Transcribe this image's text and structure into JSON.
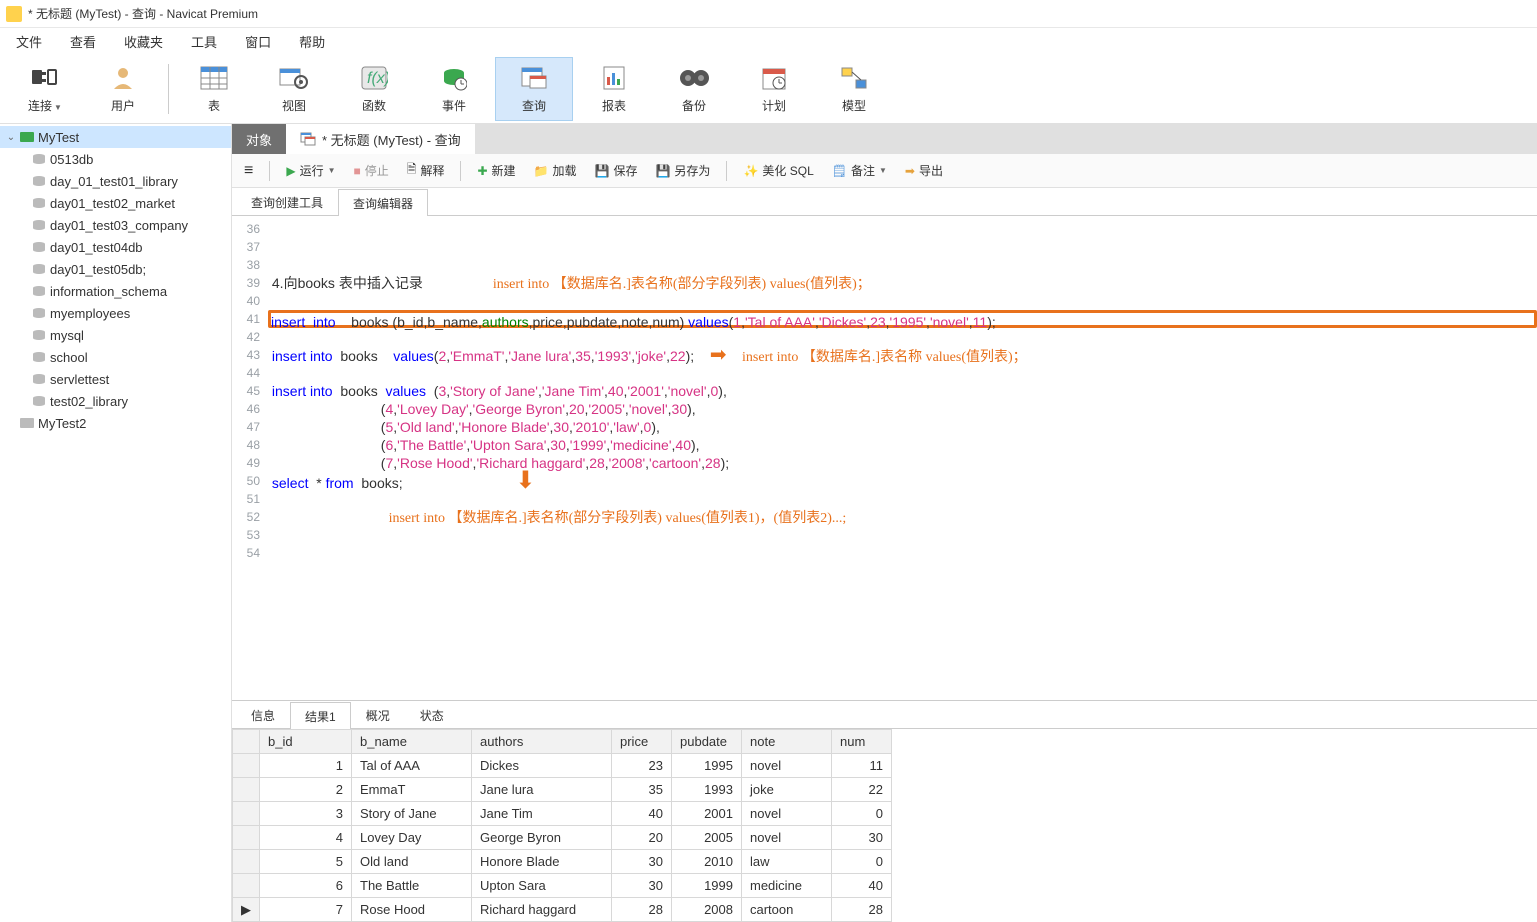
{
  "title": "* 无标题 (MyTest) - 查询 - Navicat Premium",
  "menu": [
    "文件",
    "查看",
    "收藏夹",
    "工具",
    "窗口",
    "帮助"
  ],
  "maintool": {
    "connect": "连接",
    "user": "用户",
    "table": "表",
    "view": "视图",
    "function": "函数",
    "event": "事件",
    "query": "查询",
    "report": "报表",
    "backup": "备份",
    "plan": "计划",
    "model": "模型"
  },
  "tree": {
    "root": "MyTest",
    "items": [
      "0513db",
      "day_01_test01_library",
      "day01_test02_market",
      "day01_test03_company",
      "day01_test04db",
      "day01_test05db;",
      "information_schema",
      "myemployees",
      "mysql",
      "school",
      "servlettest",
      "test02_library"
    ],
    "root2": "MyTest2"
  },
  "tabs": {
    "objects": "对象",
    "query": "* 无标题 (MyTest) - 查询"
  },
  "qtb": {
    "run": "运行",
    "stop": "停止",
    "explain": "解释",
    "new": "新建",
    "load": "加载",
    "save": "保存",
    "saveas": "另存为",
    "beautify": "美化 SQL",
    "note": "备注",
    "export": "导出"
  },
  "innertabs": {
    "builder": "查询创建工具",
    "editor": "查询编辑器"
  },
  "code": {
    "l39_comment": "4.向books 表中插入记录",
    "anno1": "insert into 【数据库名.]表名称(部分字段列表) values(值列表)；",
    "l41": "insert  into    books (b_id,b_name,authors,price,pubdate,note,num) values(1,'Tal of AAA','Dickes',23,'1995','novel',11);",
    "l43": "insert into  books    values(2,'EmmaT','Jane lura',35,'1993','joke',22);",
    "anno2": "insert into 【数据库名.]表名称 values(值列表)；",
    "l45": "insert into  books  values  (3,'Story of Jane','Jane Tim',40,'2001','novel',0),",
    "l46": "                            (4,'Lovey Day','George Byron',20,'2005','novel',30),",
    "l47": "                            (5,'Old land','Honore Blade',30,'2010','law',0),",
    "l48": "                            (6,'The Battle','Upton Sara',30,'1999','medicine',40),",
    "l49": "                            (7,'Rose Hood','Richard haggard',28,'2008','cartoon',28);",
    "l50": "select  * from  books;",
    "anno3": "insert into 【数据库名.]表名称(部分字段列表) values(值列表1)，(值列表2)...;"
  },
  "resulttabs": {
    "info": "信息",
    "res1": "结果1",
    "profile": "概况",
    "status": "状态"
  },
  "grid": {
    "headers": [
      "b_id",
      "b_name",
      "authors",
      "price",
      "pubdate",
      "note",
      "num"
    ],
    "rows": [
      {
        "b_id": 1,
        "b_name": "Tal of AAA",
        "authors": "Dickes",
        "price": 23,
        "pubdate": 1995,
        "note": "novel",
        "num": 11
      },
      {
        "b_id": 2,
        "b_name": "EmmaT",
        "authors": "Jane lura",
        "price": 35,
        "pubdate": 1993,
        "note": "joke",
        "num": 22
      },
      {
        "b_id": 3,
        "b_name": "Story of Jane",
        "authors": "Jane Tim",
        "price": 40,
        "pubdate": 2001,
        "note": "novel",
        "num": 0
      },
      {
        "b_id": 4,
        "b_name": "Lovey Day",
        "authors": "George Byron",
        "price": 20,
        "pubdate": 2005,
        "note": "novel",
        "num": 30
      },
      {
        "b_id": 5,
        "b_name": "Old land",
        "authors": "Honore Blade",
        "price": 30,
        "pubdate": 2010,
        "note": "law",
        "num": 0
      },
      {
        "b_id": 6,
        "b_name": "The Battle",
        "authors": "Upton Sara",
        "price": 30,
        "pubdate": 1999,
        "note": "medicine",
        "num": 40
      },
      {
        "b_id": 7,
        "b_name": "Rose Hood",
        "authors": "Richard haggard",
        "price": 28,
        "pubdate": 2008,
        "note": "cartoon",
        "num": 28
      }
    ]
  },
  "chart_data": {
    "type": "table",
    "title": "books",
    "headers": [
      "b_id",
      "b_name",
      "authors",
      "price",
      "pubdate",
      "note",
      "num"
    ],
    "rows": [
      [
        1,
        "Tal of AAA",
        "Dickes",
        23,
        1995,
        "novel",
        11
      ],
      [
        2,
        "EmmaT",
        "Jane lura",
        35,
        1993,
        "joke",
        22
      ],
      [
        3,
        "Story of Jane",
        "Jane Tim",
        40,
        2001,
        "novel",
        0
      ],
      [
        4,
        "Lovey Day",
        "George Byron",
        20,
        2005,
        "novel",
        30
      ],
      [
        5,
        "Old land",
        "Honore Blade",
        30,
        2010,
        "law",
        0
      ],
      [
        6,
        "The Battle",
        "Upton Sara",
        30,
        1999,
        "medicine",
        40
      ],
      [
        7,
        "Rose Hood",
        "Richard haggard",
        28,
        2008,
        "cartoon",
        28
      ]
    ]
  }
}
